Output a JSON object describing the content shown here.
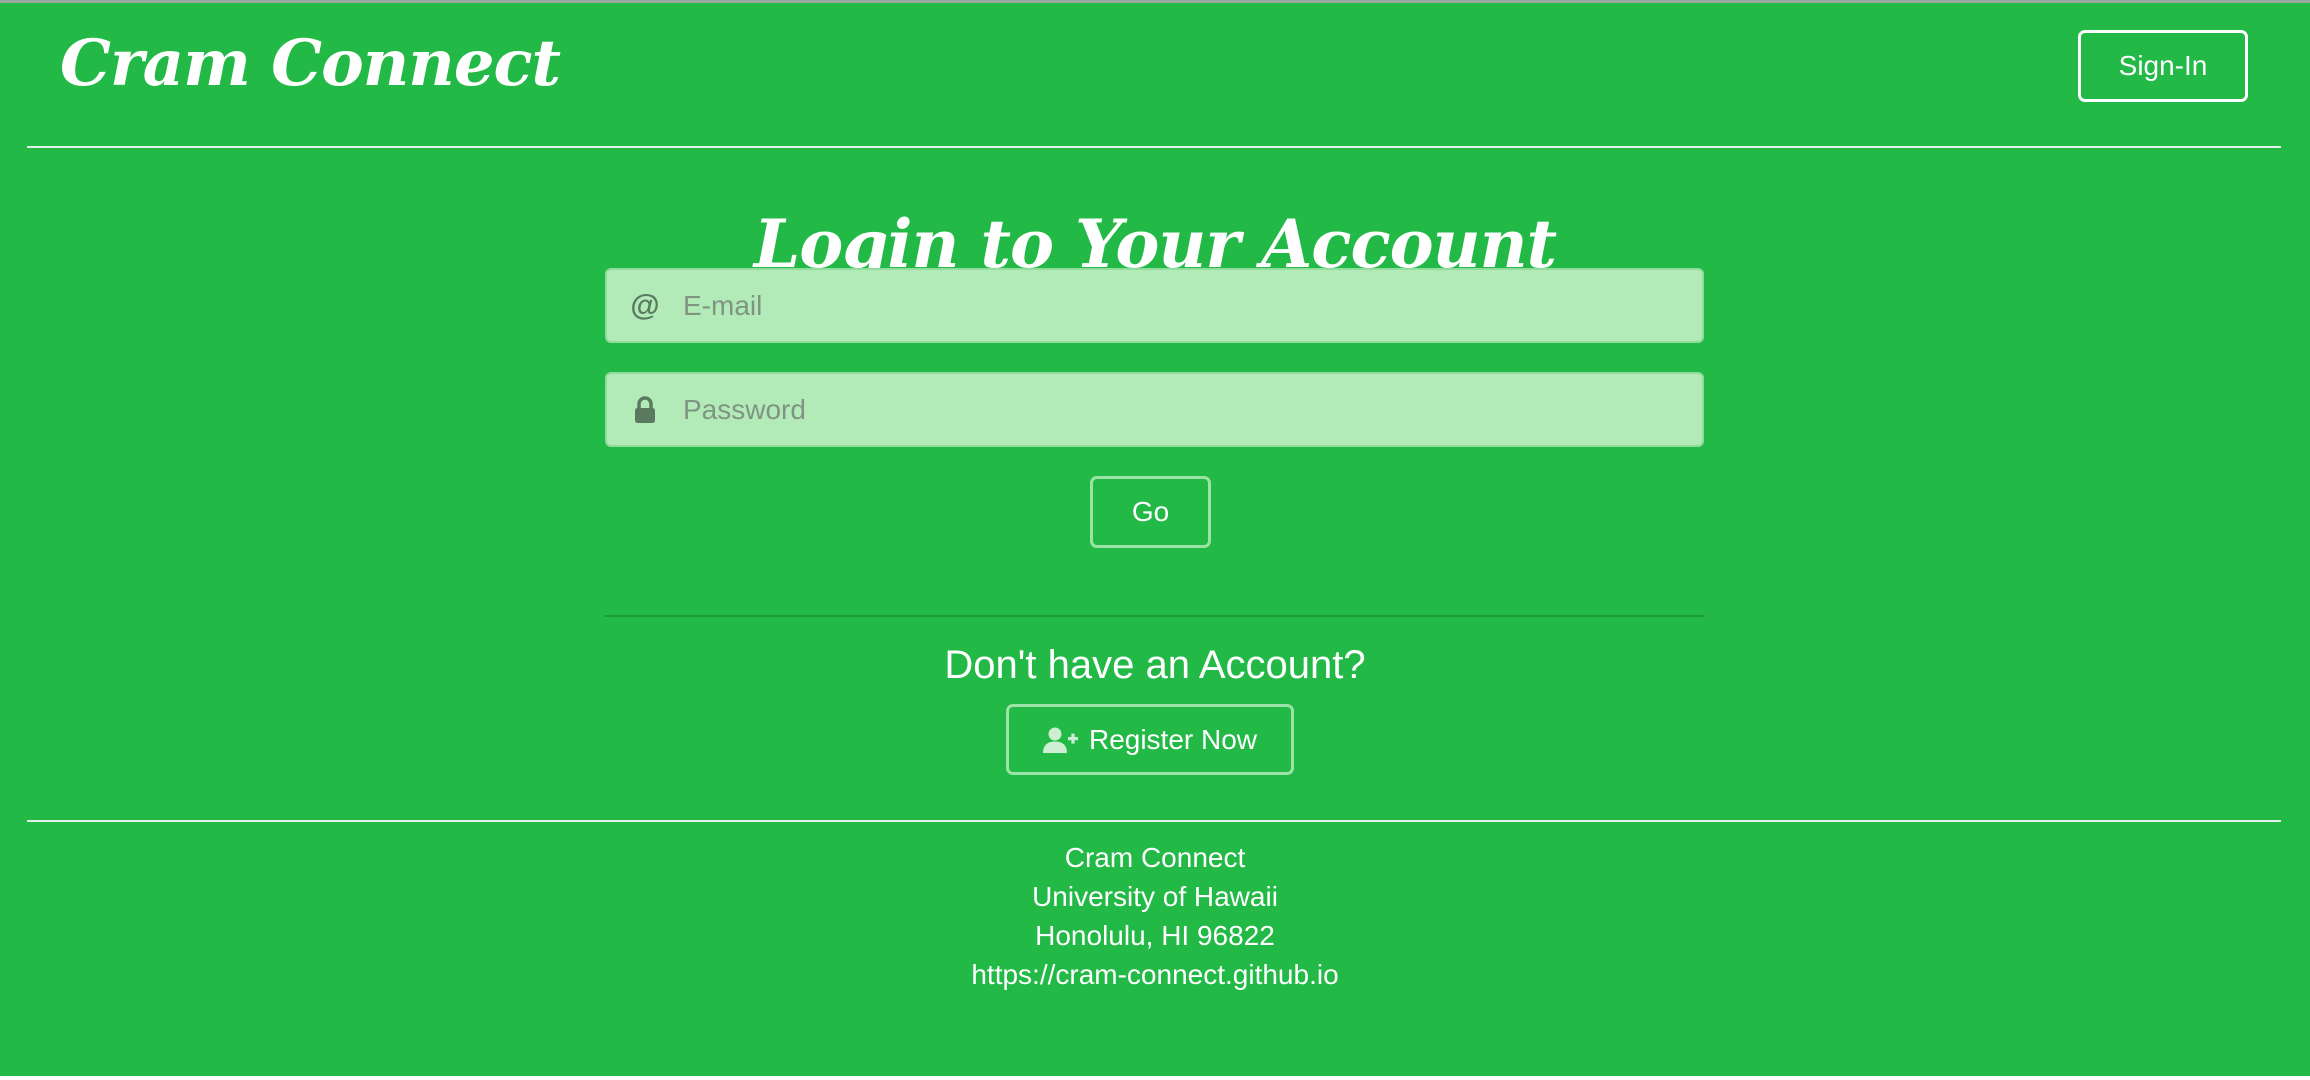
{
  "header": {
    "brand": "Cram Connect",
    "signin_label": "Sign-In"
  },
  "login": {
    "title": "Login to Your Account",
    "email": {
      "icon": "at-icon",
      "placeholder": "E-mail",
      "value": ""
    },
    "password": {
      "icon": "lock-icon",
      "placeholder": "Password",
      "value": ""
    },
    "submit_label": "Go"
  },
  "register": {
    "prompt": "Don't have an Account?",
    "button_icon": "user-plus-icon",
    "button_label": "Register Now"
  },
  "footer": {
    "lines": [
      "Cram Connect",
      "University of Hawaii",
      "Honolulu, HI 96822",
      "https://cram-connect.github.io"
    ]
  },
  "colors": {
    "background": "#22b946",
    "input_background": "#b2ebb8",
    "text": "#ffffff"
  }
}
